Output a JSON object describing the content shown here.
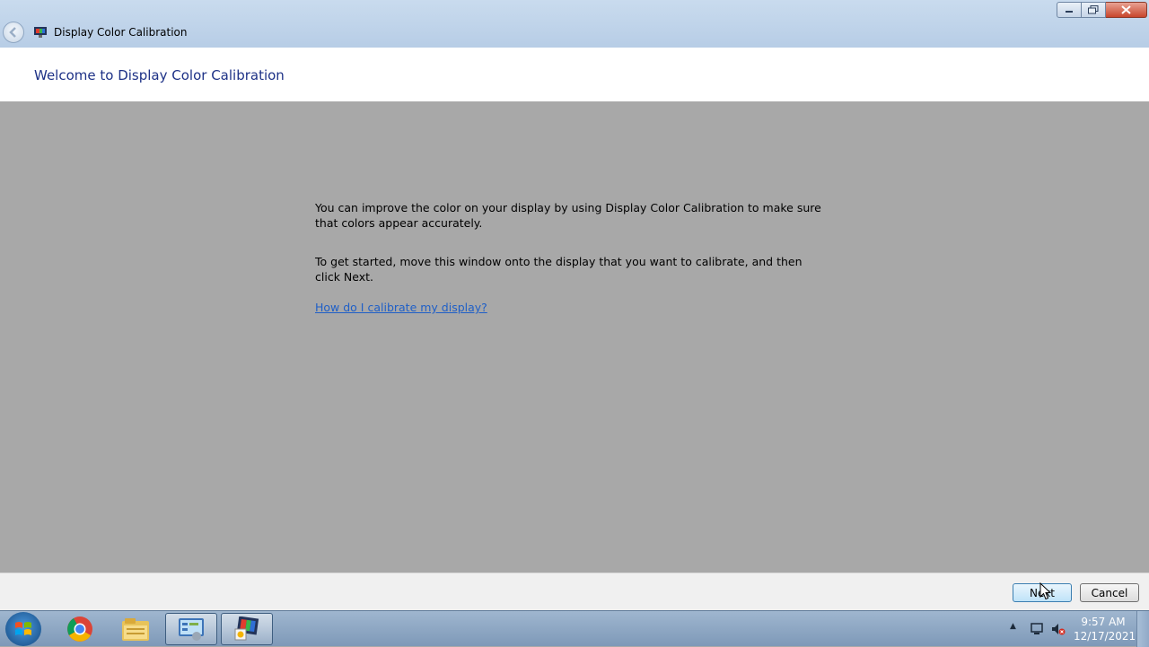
{
  "window": {
    "title": "Display Color Calibration",
    "controls": {
      "minimize": "minimize",
      "maximize": "maximize",
      "close": "close"
    }
  },
  "header": {
    "title": "Welcome to Display Color Calibration"
  },
  "content": {
    "paragraph1": "You can improve the color on your display by using Display Color Calibration to make sure that colors appear accurately.",
    "paragraph2": "To get started, move this window onto the display that you want to calibrate, and then click Next.",
    "help_link": "How do I calibrate my display?"
  },
  "footer": {
    "next_label": "Next",
    "cancel_label": "Cancel"
  },
  "taskbar": {
    "items": [
      "chrome-icon",
      "file-explorer-icon",
      "control-panel-icon",
      "display-calibration-icon"
    ],
    "clock_time": "9:57 AM",
    "clock_date": "12/17/2021"
  },
  "colors": {
    "accent": "#1e3287",
    "link": "#1f5fc7",
    "content_bg": "#a8a8a8"
  }
}
